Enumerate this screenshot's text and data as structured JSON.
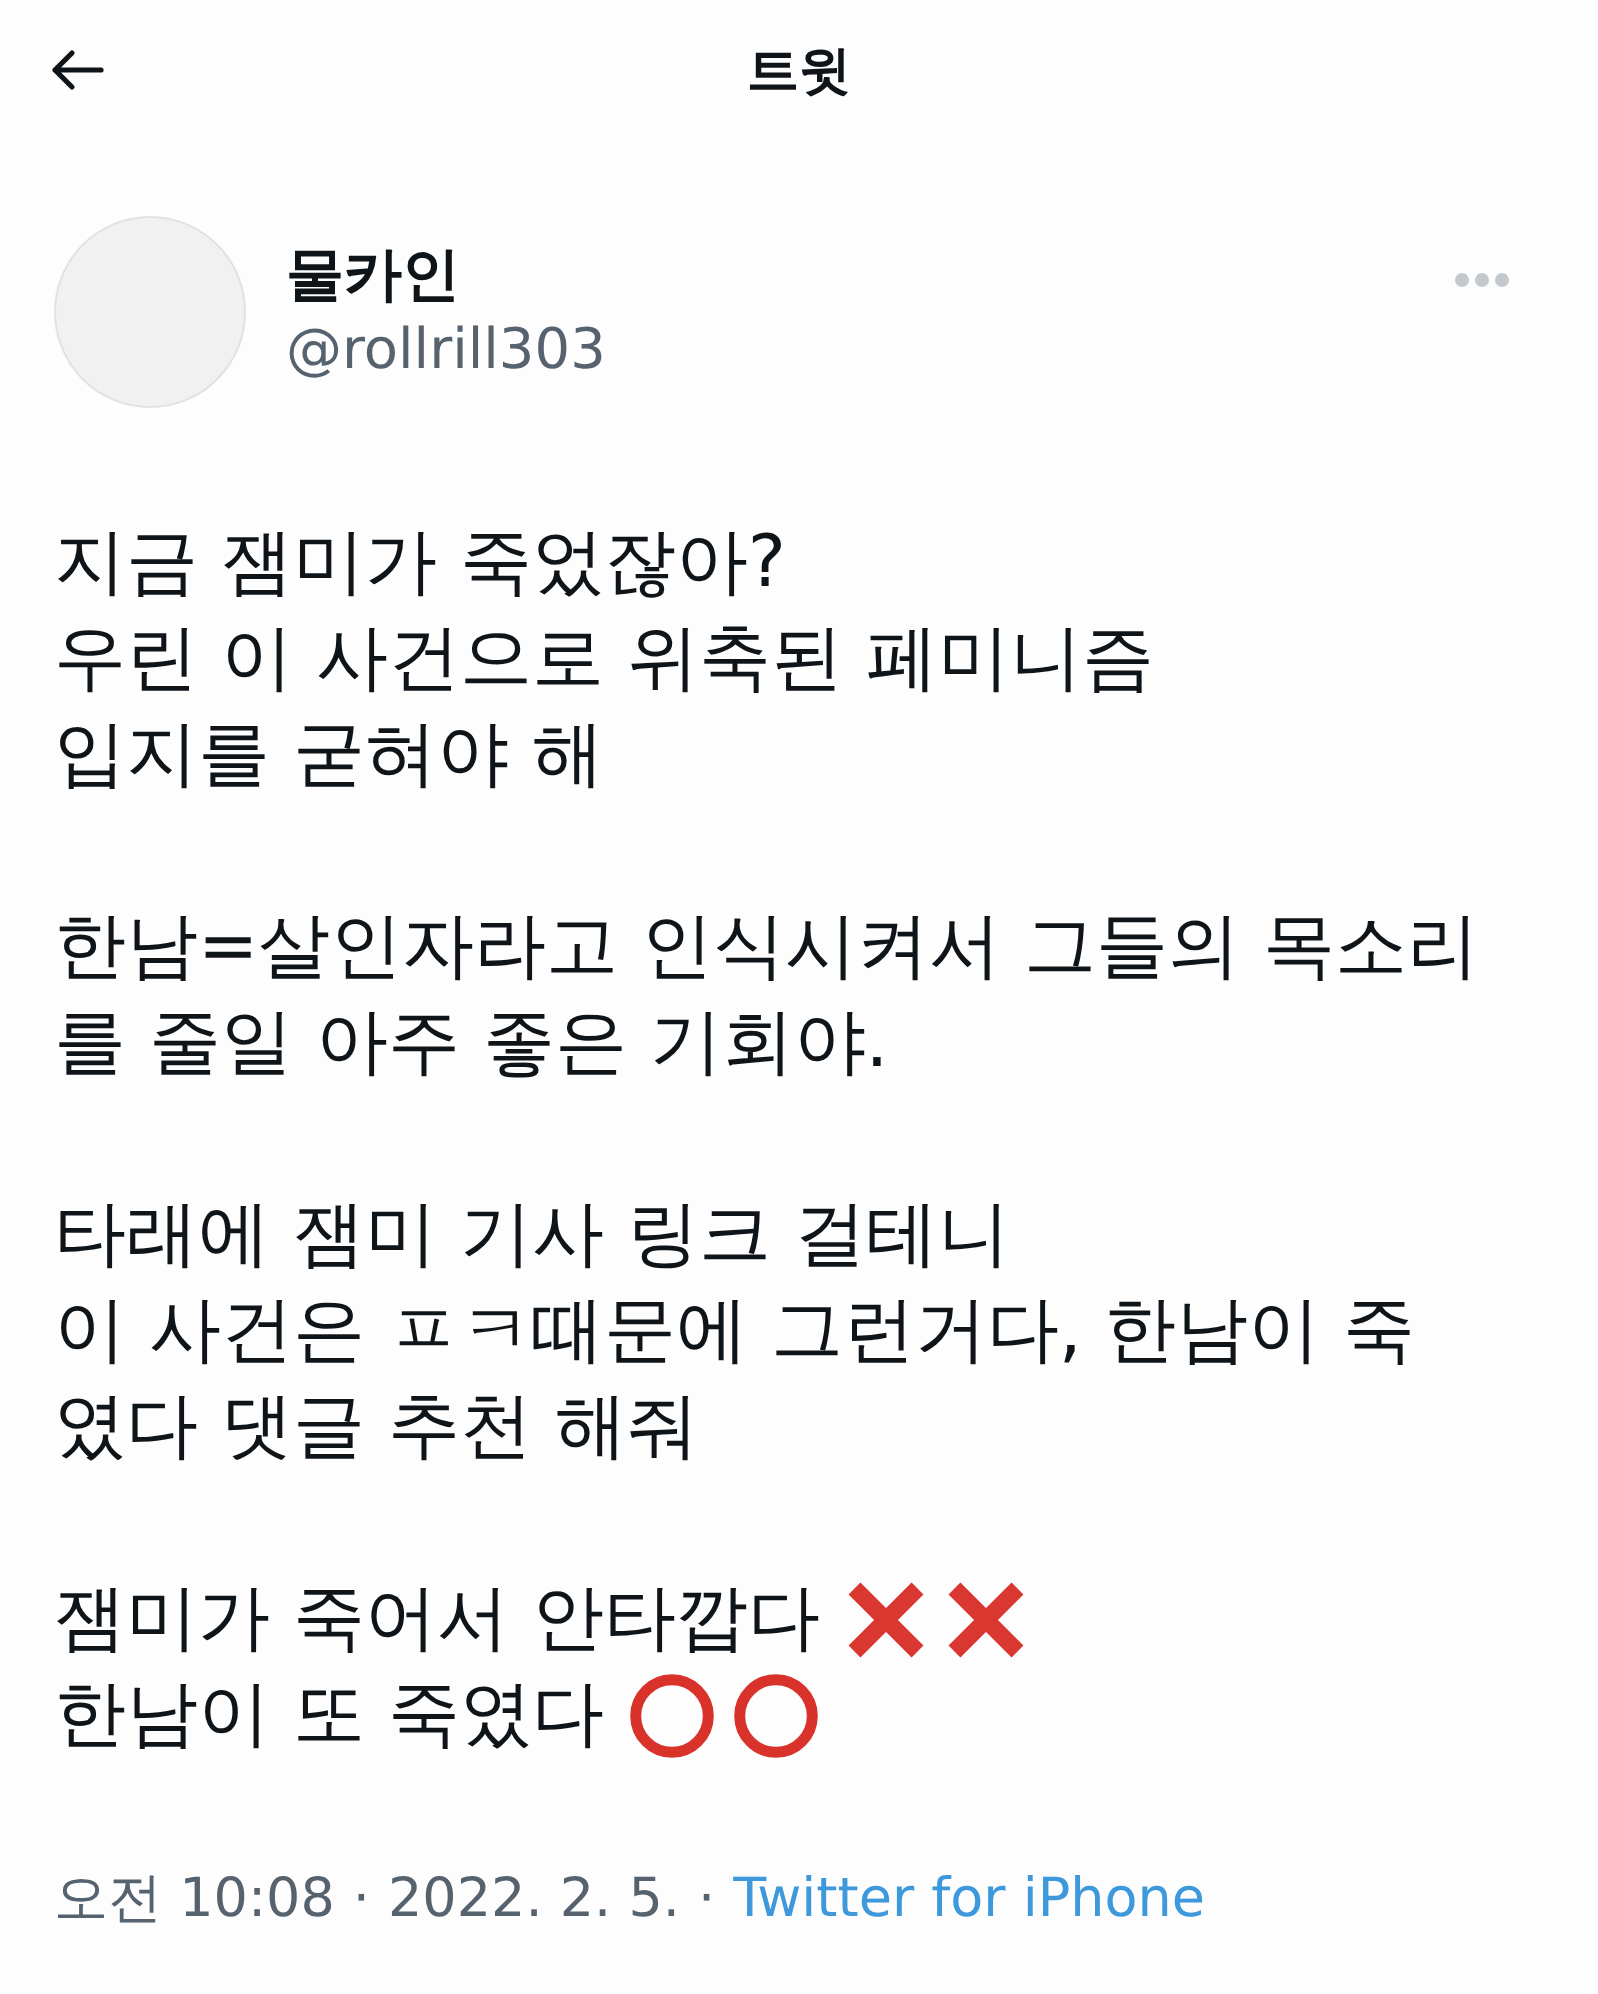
{
  "header": {
    "title": "트윗"
  },
  "author": {
    "name": "물카인",
    "handle": "@rollrill303"
  },
  "body": [
    {
      "lines": [
        {
          "text": "지금 잼미가 죽었잖아?"
        },
        {
          "text": "우린 이 사건으로 위축된 페미니즘"
        },
        {
          "text": "입지를 굳혀야 해"
        }
      ]
    },
    {
      "lines": [
        {
          "text": "한남=살인자라고 인식시켜서 그들의 목소리"
        },
        {
          "text": "를 줄일 아주 좋은 기회야."
        }
      ]
    },
    {
      "lines": [
        {
          "text": "타래에 잼미 기사 링크 걸테니"
        },
        {
          "text": "이 사건은 ㅍㅋ때문에 그런거다, 한남이 죽"
        },
        {
          "text": "였다 댓글 추천 해줘"
        }
      ]
    },
    {
      "lines": [
        {
          "text": "잼미가 죽어서 안타깝다",
          "marks": [
            {
              "kind": "cross"
            },
            {
              "kind": "cross"
            }
          ]
        },
        {
          "text": "한남이 또 죽였다",
          "marks": [
            {
              "kind": "ring"
            },
            {
              "kind": "ring"
            }
          ]
        }
      ]
    }
  ],
  "meta": [
    {
      "kind": "time",
      "text": "오전 10:08"
    },
    {
      "kind": "separator",
      "text": "·"
    },
    {
      "kind": "date",
      "text": "2022. 2. 5."
    },
    {
      "kind": "separator",
      "text": "·"
    },
    {
      "kind": "link",
      "text": "Twitter for iPhone"
    }
  ]
}
